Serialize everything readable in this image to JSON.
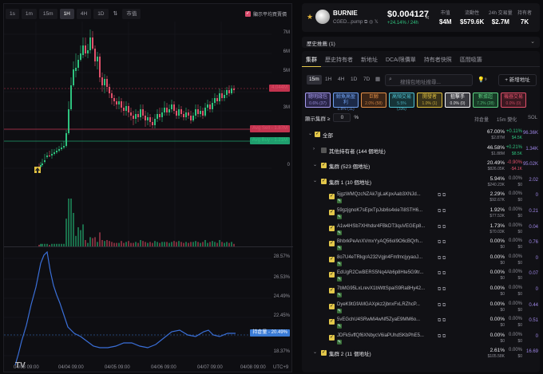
{
  "chart": {
    "timeframes": [
      "1s",
      "1m",
      "15m",
      "1H",
      "4H",
      "1D"
    ],
    "active_timeframe": "1H",
    "market_cap_toggle": "市值",
    "avg_price_toggle_label": "顯示平均買賣價",
    "price_scale": [
      "7M",
      "6M",
      "5M",
      "4M",
      "3M",
      "2M",
      "1M",
      "0"
    ],
    "current_price_label": "4.044M",
    "avg_sell_label": "Avg Sell - 1.87M",
    "avg_buy_label": "Avg Buy - 1.21M",
    "pct_scale": [
      "28.57%",
      "26.53%",
      "24.49%",
      "22.45%",
      "20.41%",
      "18.37%"
    ],
    "holding_label": "持倉量 - 20.49%",
    "x_labels": [
      "04/03 09:00",
      "04/04 09:00",
      "04/05 09:00",
      "04/06 09:00",
      "04/07 09:00",
      "04/08 09:00"
    ],
    "timezone": "UTC+9"
  },
  "token": {
    "name": "BURNIE",
    "address": "CGED...pump",
    "price": "$0.004127",
    "change": "+24.14% / 24h",
    "stats": [
      {
        "label": "市值",
        "value": "$4M"
      },
      {
        "label": "流動性",
        "value": "$579.6K"
      },
      {
        "label": "24h 交易量",
        "value": "$2.7M"
      },
      {
        "label": "持有者",
        "value": "7K"
      }
    ]
  },
  "history": {
    "label": "歷史推薦 (1)"
  },
  "tabs": [
    "集群",
    "歷史持有者",
    "新地址",
    "DCA/限價單",
    "持有者快照",
    "區間吸籌"
  ],
  "active_tab": "集群",
  "small_timeframes": [
    "15m",
    "1H",
    "4H",
    "1D",
    "7D"
  ],
  "search_placeholder": "搜錢包地址搜尋...",
  "add_address": "+ 新增地址",
  "chips": [
    {
      "label": "聰明錢包",
      "count": "0.6% (37)",
      "fg": "#a89cf0",
      "bg": "#2a2548"
    },
    {
      "label": "鯨魚高盈利",
      "count": "1.8% (11)",
      "fg": "#6fa0f0",
      "bg": "#1c2a48"
    },
    {
      "label": "巨鯨",
      "count": "2.0% (58)",
      "fg": "#e49048",
      "bg": "#3a2416"
    },
    {
      "label": "高頻交易",
      "count": "5.5% (336)",
      "fg": "#4fc0d0",
      "bg": "#163438"
    },
    {
      "label": "開發者",
      "count": "1.0% (1)",
      "fg": "#e0c040",
      "bg": "#38321a"
    },
    {
      "label": "狙擊手",
      "count": "0.0% (0)",
      "fg": "#ffffff",
      "bg": "#3a3a40"
    },
    {
      "label": "數據超",
      "count": "7.2% (28)",
      "fg": "#5cd080",
      "bg": "#173a26"
    },
    {
      "label": "機器交易",
      "count": "0.0% (0)",
      "fg": "#e0506a",
      "bg": "#3a1820"
    }
  ],
  "threshold": {
    "label": "顯示集群 ≥",
    "value": "0",
    "unit": "%"
  },
  "columns": {
    "holdings": "持倉量",
    "change": "15m 變化",
    "sol": "SOL"
  },
  "rows": [
    {
      "level": 0,
      "kind": "group",
      "label": "全部",
      "h1": "67.00%",
      "h2": "$2.87M",
      "c1": "+0.11%",
      "c2": "$4.5K",
      "c1cls": "green",
      "sol": "96.36K",
      "solcls": "purple"
    },
    {
      "level": 1,
      "kind": "group-off",
      "label": "其他持有者 (144 個地址)",
      "h1": "46.58%",
      "h2": "$1.88M",
      "c1": "+0.21%",
      "c2": "$8.5K",
      "c1cls": "green",
      "sol": "1.34K",
      "solcls": "purple"
    },
    {
      "level": 1,
      "kind": "group",
      "label": "集群 (523 個地址)",
      "h1": "20.49%",
      "h2": "$826.05K",
      "c1": "-0.90%",
      "c2": "-$4.1K",
      "c1cls": "red",
      "sol": "95.02K",
      "solcls": "purple"
    },
    {
      "level": 2,
      "kind": "group",
      "label": "集群 1 (10 個地址)",
      "h1": "5.94%",
      "h2": "$240.23K",
      "c1": "0.00%",
      "c2": "$0",
      "c1cls": "dim",
      "sol": "2.02",
      "solcls": "purple"
    },
    {
      "level": 3,
      "kind": "addr",
      "label": "5jgzWMQzcNZAk7gLaKpxAab3XNJd...",
      "h1": "2.29%",
      "h2": "$92.67K",
      "c1": "0.00%",
      "c2": "$0",
      "c1cls": "dim",
      "sol": "0",
      "solcls": "purple"
    },
    {
      "level": 3,
      "kind": "addr",
      "label": "59gzjgnoK7sEpxTpJsb6s4xie7i8STH6...",
      "h1": "1.92%",
      "h2": "$77.53K",
      "c1": "0.00%",
      "c2": "$0",
      "c1cls": "dim",
      "sol": "0.21",
      "solcls": "purple"
    },
    {
      "level": 3,
      "kind": "addr",
      "label": "A1w4HSb7XHhdsr4FBkDT3quVEGEp8...",
      "h1": "1.73%",
      "h2": "$70.03K",
      "c1": "0.00%",
      "c2": "$0",
      "c1cls": "dim",
      "sol": "0.04",
      "solcls": "purple"
    },
    {
      "level": 3,
      "kind": "addr",
      "label": "BhbrkPeAnXVmxYyAQ56oI9O6cBQrh...",
      "h1": "0.00%",
      "h2": "$0",
      "c1": "0.00%",
      "c2": "$0",
      "c1cls": "dim",
      "sol": "0.76",
      "solcls": "purple"
    },
    {
      "level": 3,
      "kind": "addr",
      "label": "8o7U4eTRkgrA232Vgjn4FmfmcjyyaoJ...",
      "h1": "0.00%",
      "h2": "$0",
      "c1": "0.00%",
      "c2": "$0",
      "c1cls": "dim",
      "sol": "0",
      "solcls": "purple"
    },
    {
      "level": 3,
      "kind": "addr",
      "label": "EdUgR2CwBERS5Nq4Ab6p8Hte5G9tr...",
      "h1": "0.00%",
      "h2": "$0",
      "c1": "0.00%",
      "c2": "$0",
      "c1cls": "dim",
      "sol": "0.07",
      "solcls": "purple"
    },
    {
      "level": 3,
      "kind": "addr",
      "label": "7bMG95LxLrevX1bWttSpaiS9Ra8Hy42...",
      "h1": "0.00%",
      "h2": "$0",
      "c1": "0.00%",
      "c2": "$0",
      "c1cls": "dim",
      "sol": "0",
      "solcls": "purple"
    },
    {
      "level": 3,
      "kind": "addr",
      "label": "DyeK9tGfAMGAXpkz2jbnxFxLRZhcP...",
      "h1": "0.00%",
      "h2": "$0",
      "c1": "0.00%",
      "c2": "$0",
      "c1cls": "dim",
      "sol": "0.44",
      "solcls": "purple"
    },
    {
      "level": 3,
      "kind": "addr",
      "label": "5vEGchU4SRwMi4wNf5ZyaE9MM6o...",
      "h1": "0.00%",
      "h2": "$0",
      "c1": "0.00%",
      "c2": "$0",
      "c1cls": "dim",
      "sol": "0.51",
      "solcls": "purple"
    },
    {
      "level": 3,
      "kind": "addr",
      "label": "JDFk5vffQf6XNbycV6iaPUhdSKbPhE5...",
      "h1": "0.00%",
      "h2": "$0",
      "c1": "0.00%",
      "c2": "$0",
      "c1cls": "dim",
      "sol": "0",
      "solcls": "purple"
    },
    {
      "level": 2,
      "kind": "group",
      "label": "集群 2 (11 個地址)",
      "h1": "2.61%",
      "h2": "$105.58K",
      "c1": "0.00%",
      "c2": "$0",
      "c1cls": "dim",
      "sol": "16.69",
      "solcls": "purple"
    }
  ]
}
